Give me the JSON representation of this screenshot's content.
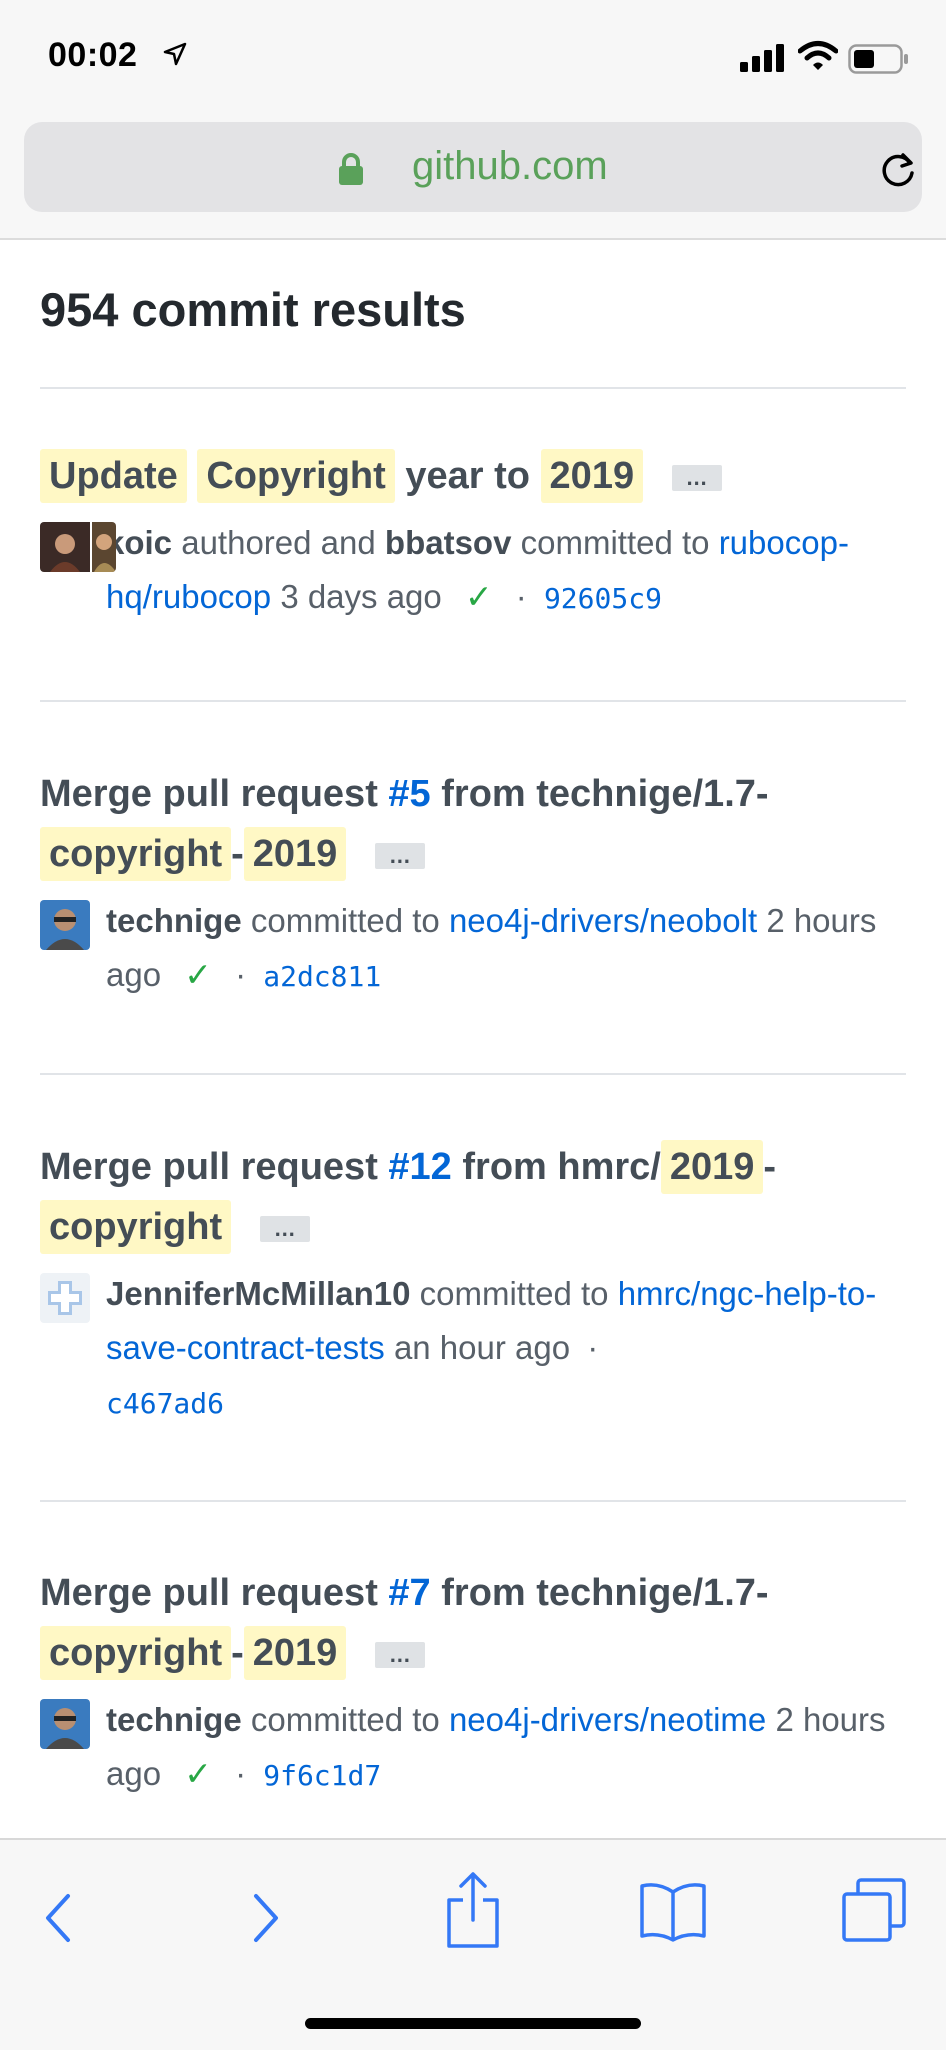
{
  "status_bar": {
    "time": "00:02"
  },
  "browser": {
    "url_domain": "github.com"
  },
  "results": {
    "heading": "954 commit results"
  },
  "commits": [
    {
      "title_words": [
        "Update",
        "Copyright",
        "year to",
        "2019"
      ],
      "ellipsis": "…",
      "author": "koic",
      "authored_and": "authored and",
      "committer": "bbatsov",
      "committed_to": "committed to",
      "repo": "rubocop-hq/rubocop",
      "time": "3 days ago",
      "check": "✓",
      "dot": "·",
      "sha": "92605c9"
    },
    {
      "title_prefix": "Merge pull request",
      "pr": "#5",
      "title_from": "from technige/1.7-",
      "title_hl1": "copyright",
      "title_sep": "-",
      "title_hl2": "2019",
      "ellipsis": "…",
      "committer": "technige",
      "committed_to": "committed to",
      "repo": "neo4j-drivers/neobolt",
      "time": "2 hours ago",
      "check": "✓",
      "dot": "·",
      "sha": "a2dc811"
    },
    {
      "title_prefix": "Merge pull request",
      "pr": "#12",
      "title_from": "from hmrc/",
      "title_hl1": "2019",
      "title_sep": "-",
      "title_hl2": "copyright",
      "ellipsis": "…",
      "committer": "JenniferMcMillan10",
      "committed_to": "committed to",
      "repo": "hmrc/ngc-help-to-save-contract-tests",
      "time": "an hour ago",
      "dot": "·",
      "sha": "c467ad6"
    },
    {
      "title_prefix": "Merge pull request",
      "pr": "#7",
      "title_from": "from technige/1.7-",
      "title_hl1": "copyright",
      "title_sep": "-",
      "title_hl2": "2019",
      "ellipsis": "…",
      "committer": "technige",
      "committed_to": "committed to",
      "repo": "neo4j-drivers/neotime",
      "time": "2 hours ago",
      "check": "✓",
      "dot": "·",
      "sha": "9f6c1d7"
    }
  ],
  "icons": {
    "accent": "#0366d6",
    "toolbar_blue": "#3478f6",
    "check_green": "#28a745",
    "lock_green": "#5aa15a",
    "highlight": "#fff8c5"
  }
}
